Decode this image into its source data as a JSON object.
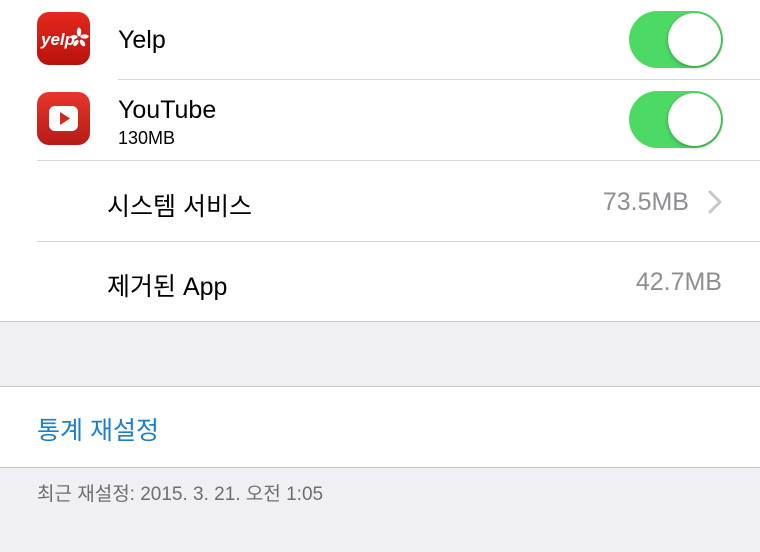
{
  "apps": [
    {
      "name": "Yelp",
      "size": "",
      "icon": "yelp-logo-icon",
      "enabled": true,
      "icon_text": "yelp"
    },
    {
      "name": "YouTube",
      "size": "130MB",
      "icon": "youtube-play-icon",
      "enabled": true
    }
  ],
  "system_services": {
    "label": "시스템 서비스",
    "value": "73.5MB"
  },
  "removed_apps": {
    "label": "제거된 App",
    "value": "42.7MB"
  },
  "reset": {
    "label": "통계 재설정"
  },
  "footer": {
    "last_reset": "최근 재설정: 2015. 3. 21. 오전 1:05"
  },
  "colors": {
    "toggle_on": "#4cd964",
    "link": "#1a7fcf",
    "secondary_text": "#8e8e93",
    "background": "#efeff4"
  }
}
